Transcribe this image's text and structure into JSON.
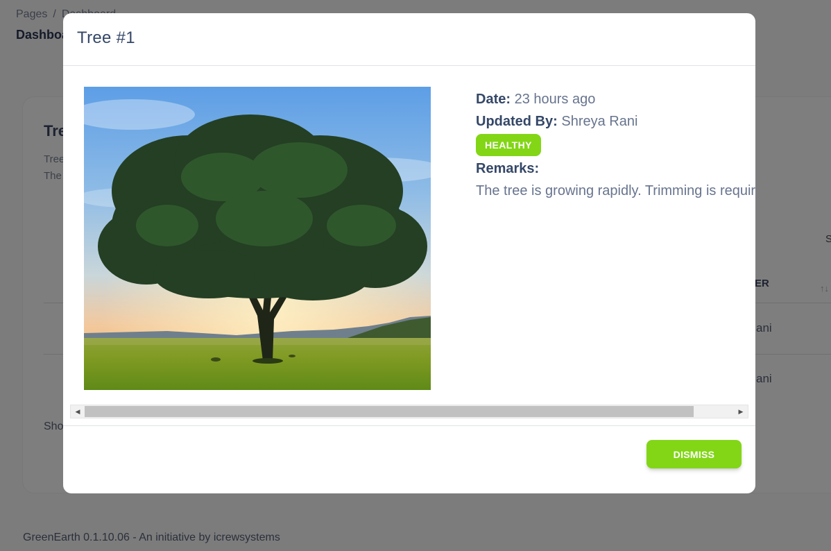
{
  "background": {
    "breadcrumb": {
      "root": "Pages",
      "separator": "/",
      "current": "Dashboard"
    },
    "page_title": "Dashboard",
    "card": {
      "title_fragment": "Tre",
      "subtitle_line1_fragment": "Tree",
      "subtitle_line2_fragment": "The",
      "right_fragment": "S",
      "column_header_fragment": "ER",
      "sort_icon": "↑↓",
      "cell1_fragment": "ani",
      "cell2_fragment": "ani",
      "show_fragment": "Sho"
    },
    "footer": "GreenEarth 0.1.10.06 - An initiative by icrewsystems"
  },
  "modal": {
    "title": "Tree #1",
    "image_subject": "tree",
    "details": {
      "date_label": "Date:",
      "date_value": "23 hours ago",
      "updated_label": "Updated By:",
      "updated_value": "Shreya Rani",
      "status": "HEALTHY",
      "status_color": "#82d616",
      "remarks_label": "Remarks:",
      "remarks_value": "The tree is growing rapidly. Trimming is required"
    },
    "dismiss_label": "DISMISS",
    "accent_color": "#82d616"
  }
}
